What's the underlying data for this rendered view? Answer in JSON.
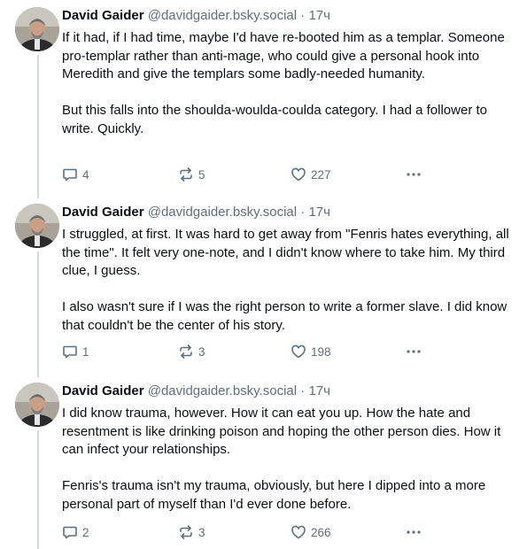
{
  "posts": [
    {
      "author": "David Gaider",
      "handle": "@davidgaider.bsky.social",
      "separator": "·",
      "time": "17ч",
      "text": "If it had, if I had time, maybe I'd have re-booted him as a templar. Someone pro-templar rather than anti-mage, who could give a personal hook into Meredith and give the templars some badly-needed humanity.\n\nBut this falls into the shoulda-woulda-coulda category. I had a follower to write. Quickly.",
      "replies": "4",
      "reposts": "5",
      "likes": "227"
    },
    {
      "author": "David Gaider",
      "handle": "@davidgaider.bsky.social",
      "separator": "·",
      "time": "17ч",
      "text": "I struggled, at first. It was hard to get away from \"Fenris hates everything, all the time\". It felt very one-note, and I didn't know where to take him. My third clue, I guess.\n\nI also wasn't sure if I was the right person to write a former slave. I did know that couldn't be the center of his story.",
      "replies": "1",
      "reposts": "3",
      "likes": "198"
    },
    {
      "author": "David Gaider",
      "handle": "@davidgaider.bsky.social",
      "separator": "·",
      "time": "17ч",
      "text": "I did know trauma, however. How it can eat you up. How the hate and resentment is like drinking poison and hoping the other person dies. How it can infect your relationships.\n\nFenris's trauma isn't my trauma, obviously, but here I dipped into a more personal part of myself than I'd ever done before.",
      "replies": "2",
      "reposts": "3",
      "likes": "266"
    }
  ],
  "icons": {
    "reply": "speech-bubble-icon",
    "repost": "repost-arrows-icon",
    "like": "heart-icon",
    "more": "ellipsis-icon"
  },
  "colors": {
    "text": "#0b0f14",
    "muted": "#5f6e7e",
    "thread_line": "#d4dbe2"
  }
}
